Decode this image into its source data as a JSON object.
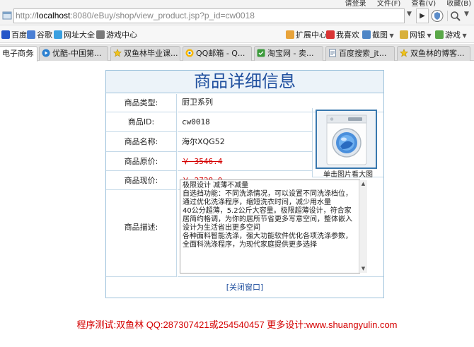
{
  "browser": {
    "top_menu": [
      "请登录",
      "文件(F)",
      "查看(V)",
      "收藏(B)"
    ],
    "address": {
      "scheme": "http://",
      "host": "localhost",
      "rest": ":8080/eBuy/shop/view_product.jsp?p_id=cw0018"
    },
    "favorites": [
      "百度",
      "谷歌",
      "网址大全",
      "游戏中心",
      "扩展中心",
      "我喜欢",
      "截图",
      "网银",
      "游戏"
    ],
    "tabs": [
      {
        "label": "电子商务",
        "active": true
      },
      {
        "label": "优酷-中国第...",
        "active": false
      },
      {
        "label": "双鱼林毕业课...",
        "active": false
      },
      {
        "label": "QQ邮箱 - Q...",
        "active": false
      },
      {
        "label": "淘宝网 - 卖...",
        "active": false
      },
      {
        "label": "百度搜索_jt...",
        "active": false
      },
      {
        "label": "双鱼林的博客...",
        "active": false
      }
    ],
    "colors": {
      "accent": "#1f4f9e",
      "price_red": "#d40000",
      "border": "#9fc3dc"
    }
  },
  "product": {
    "title": "商品详细信息",
    "rows": {
      "category": {
        "label": "商品类型:",
        "value": "厨卫系列"
      },
      "id": {
        "label": "商品ID:",
        "value": "cw0018"
      },
      "name": {
        "label": "商品名称:",
        "value": "海尔XQG52"
      },
      "original_price": {
        "label": "商品原价:",
        "value": "￥ 3546.4"
      },
      "current_price": {
        "label": "商品现价:",
        "value": "￥ 2728.0"
      }
    },
    "image_caption": "单击图片看大图",
    "description_label": "商品描述:",
    "description": "极限设计 减薄不减量\n自选挡功能：不同洗涤情况，可以设置不同洗涤档位，通过优化洗涤程序，缩短洗衣时间，减少用水量\n40公分超薄，5.2公斤大容量。极限超薄设计，符合家居简约格调，为你的居所节省更多写意空间，整体嵌入设计为生活省出更多空间\n各种面料智能洗涤，强大功能软件优化各项洗涤参数，全面科洗涤程序，为现代家庭提供更多选择",
    "close_label": "[关闭窗口]"
  },
  "footer": {
    "text": "程序测试:双鱼林 QQ:287307421或254540457 更多设计:www.shuangyulin.com"
  }
}
